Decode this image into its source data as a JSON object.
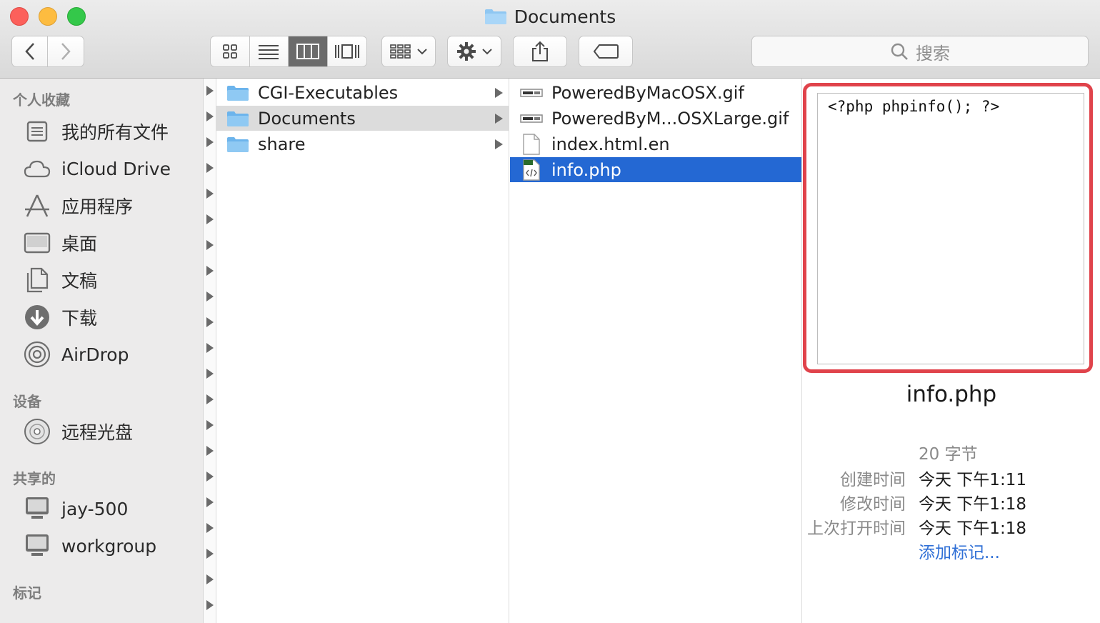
{
  "window": {
    "title": "Documents"
  },
  "toolbar": {
    "search_placeholder": "搜索"
  },
  "sidebar": {
    "sections": [
      {
        "heading": "个人收藏"
      },
      {
        "heading": "设备"
      },
      {
        "heading": "共享的"
      },
      {
        "heading": "标记"
      }
    ],
    "favorites": [
      {
        "label": "我的所有文件",
        "icon": "all-files-icon"
      },
      {
        "label": "iCloud Drive",
        "icon": "cloud-icon"
      },
      {
        "label": "应用程序",
        "icon": "applications-icon"
      },
      {
        "label": "桌面",
        "icon": "desktop-icon"
      },
      {
        "label": "文稿",
        "icon": "documents-icon"
      },
      {
        "label": "下载",
        "icon": "download-icon"
      },
      {
        "label": "AirDrop",
        "icon": "airdrop-icon"
      }
    ],
    "devices": [
      {
        "label": "远程光盘",
        "icon": "disc-icon"
      }
    ],
    "shared": [
      {
        "label": "jay-500",
        "icon": "computer-icon"
      },
      {
        "label": "workgroup",
        "icon": "computer-icon"
      }
    ]
  },
  "column1": {
    "items": [
      {
        "label": "CGI-Executables"
      },
      {
        "label": "Documents"
      },
      {
        "label": "share"
      }
    ]
  },
  "column2": {
    "items": [
      {
        "label": "PoweredByMacOSX.gif"
      },
      {
        "label": "PoweredByM...OSXLarge.gif"
      },
      {
        "label": "index.html.en"
      },
      {
        "label": "info.php"
      }
    ]
  },
  "preview": {
    "code": "<?php phpinfo(); ?>",
    "file_name": "info.php",
    "size": "20 字节",
    "created_label": "创建时间",
    "created_value": "今天 下午1:11",
    "modified_label": "修改时间",
    "modified_value": "今天 下午1:18",
    "opened_label": "上次打开时间",
    "opened_value": "今天 下午1:18",
    "add_tags": "添加标记..."
  },
  "colors": {
    "selection_blue": "#2468d3",
    "highlight_red": "#e0434b",
    "link_blue": "#2f6fd6"
  }
}
